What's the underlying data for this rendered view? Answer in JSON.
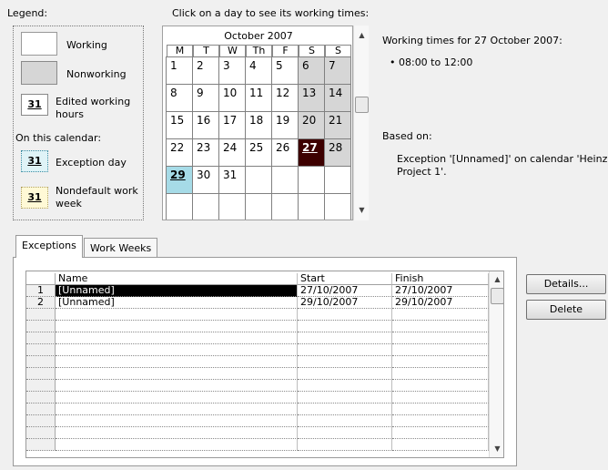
{
  "legend": {
    "title": "Legend:",
    "working": "Working",
    "nonworking": "Nonworking",
    "edited_num": "31",
    "edited_line1": "Edited working",
    "edited_line2": "hours",
    "on_this_calendar": "On this calendar:",
    "exception_num": "31",
    "exception_label": "Exception day",
    "nondefault_num": "31",
    "nondefault_line1": "Nondefault work",
    "nondefault_line2": "week"
  },
  "calendar": {
    "instruction": "Click on a day to see its working times:",
    "month_title": "October 2007",
    "weekdays": [
      "M",
      "T",
      "W",
      "Th",
      "F",
      "S",
      "S"
    ],
    "weeks": [
      [
        "1",
        "2",
        "3",
        "4",
        "5",
        "6",
        "7"
      ],
      [
        "8",
        "9",
        "10",
        "11",
        "12",
        "13",
        "14"
      ],
      [
        "15",
        "16",
        "17",
        "18",
        "19",
        "20",
        "21"
      ],
      [
        "22",
        "23",
        "24",
        "25",
        "26",
        "27",
        "28"
      ],
      [
        "29",
        "30",
        "31",
        "",
        "",
        "",
        ""
      ],
      [
        "",
        "",
        "",
        "",
        "",
        "",
        ""
      ]
    ],
    "selected_day": "27",
    "exception_day": "29"
  },
  "working_times": {
    "title": "Working times for 27 October 2007:",
    "items": [
      "• 08:00 to 12:00"
    ],
    "based_on_label": "Based on:",
    "based_on_line1": "Exception '[Unnamed]' on calendar 'Heinz",
    "based_on_line2": "Project 1'."
  },
  "tabs": [
    "Exceptions",
    "Work Weeks"
  ],
  "table": {
    "headers": [
      "Name",
      "Start",
      "Finish"
    ],
    "rows": [
      {
        "num": "1",
        "name": "[Unnamed]",
        "start": "27/10/2007",
        "finish": "27/10/2007"
      },
      {
        "num": "2",
        "name": "[Unnamed]",
        "start": "29/10/2007",
        "finish": "29/10/2007"
      }
    ]
  },
  "buttons": {
    "details": "Details...",
    "delete": "Delete"
  },
  "colors": {
    "selected_day": "#3d0000",
    "exception_day": "#a6dbe7",
    "nonworking": "#d6d6d6"
  }
}
